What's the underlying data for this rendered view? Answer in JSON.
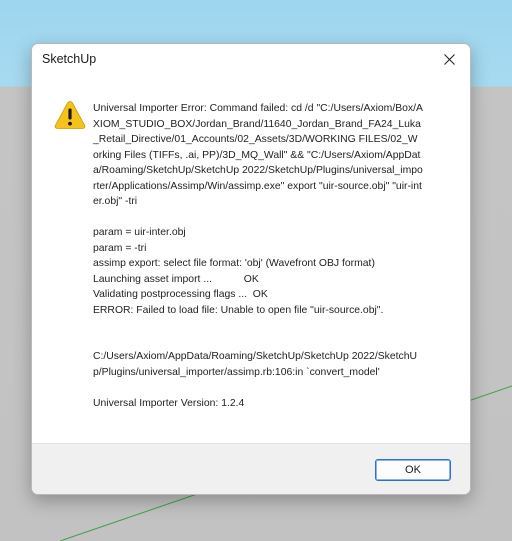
{
  "window": {
    "title": "SketchUp",
    "close_icon": "close-icon"
  },
  "dialog": {
    "icon": "warning-icon",
    "message": "Universal Importer Error: Command failed: cd /d \"C:/Users/Axiom/Box/AXIOM_STUDIO_BOX/Jordan_Brand/11640_Jordan_Brand_FA24_Luka_Retail_Directive/01_Accounts/02_Assets/3D/WORKING FILES/02_Working Files (TIFFs, .ai, PP)/3D_MQ_Wall\" && \"C:/Users/Axiom/AppData/Roaming/SketchUp/SketchUp 2022/SketchUp/Plugins/universal_importer/Applications/Assimp/Win/assimp.exe\" export \"uir-source.obj\" \"uir-inter.obj\" -tri\n\nparam = uir-inter.obj\nparam = -tri\nassimp export: select file format: 'obj' (Wavefront OBJ format)\nLaunching asset import ...           OK\nValidating postprocessing flags ...  OK\nERROR: Failed to load file: Unable to open file \"uir-source.obj\".\n\n\nC:/Users/Axiom/AppData/Roaming/SketchUp/SketchUp 2022/SketchUp/Plugins/universal_importer/assimp.rb:106:in `convert_model'\n\nUniversal Importer Version: 1.2.4",
    "ok_label": "OK"
  },
  "colors": {
    "sky": "#a6daf0",
    "ground": "#c3c3c3",
    "axis_green": "#3fa04a",
    "warning_yellow": "#f5c21b",
    "button_border": "#2d6fd2"
  }
}
